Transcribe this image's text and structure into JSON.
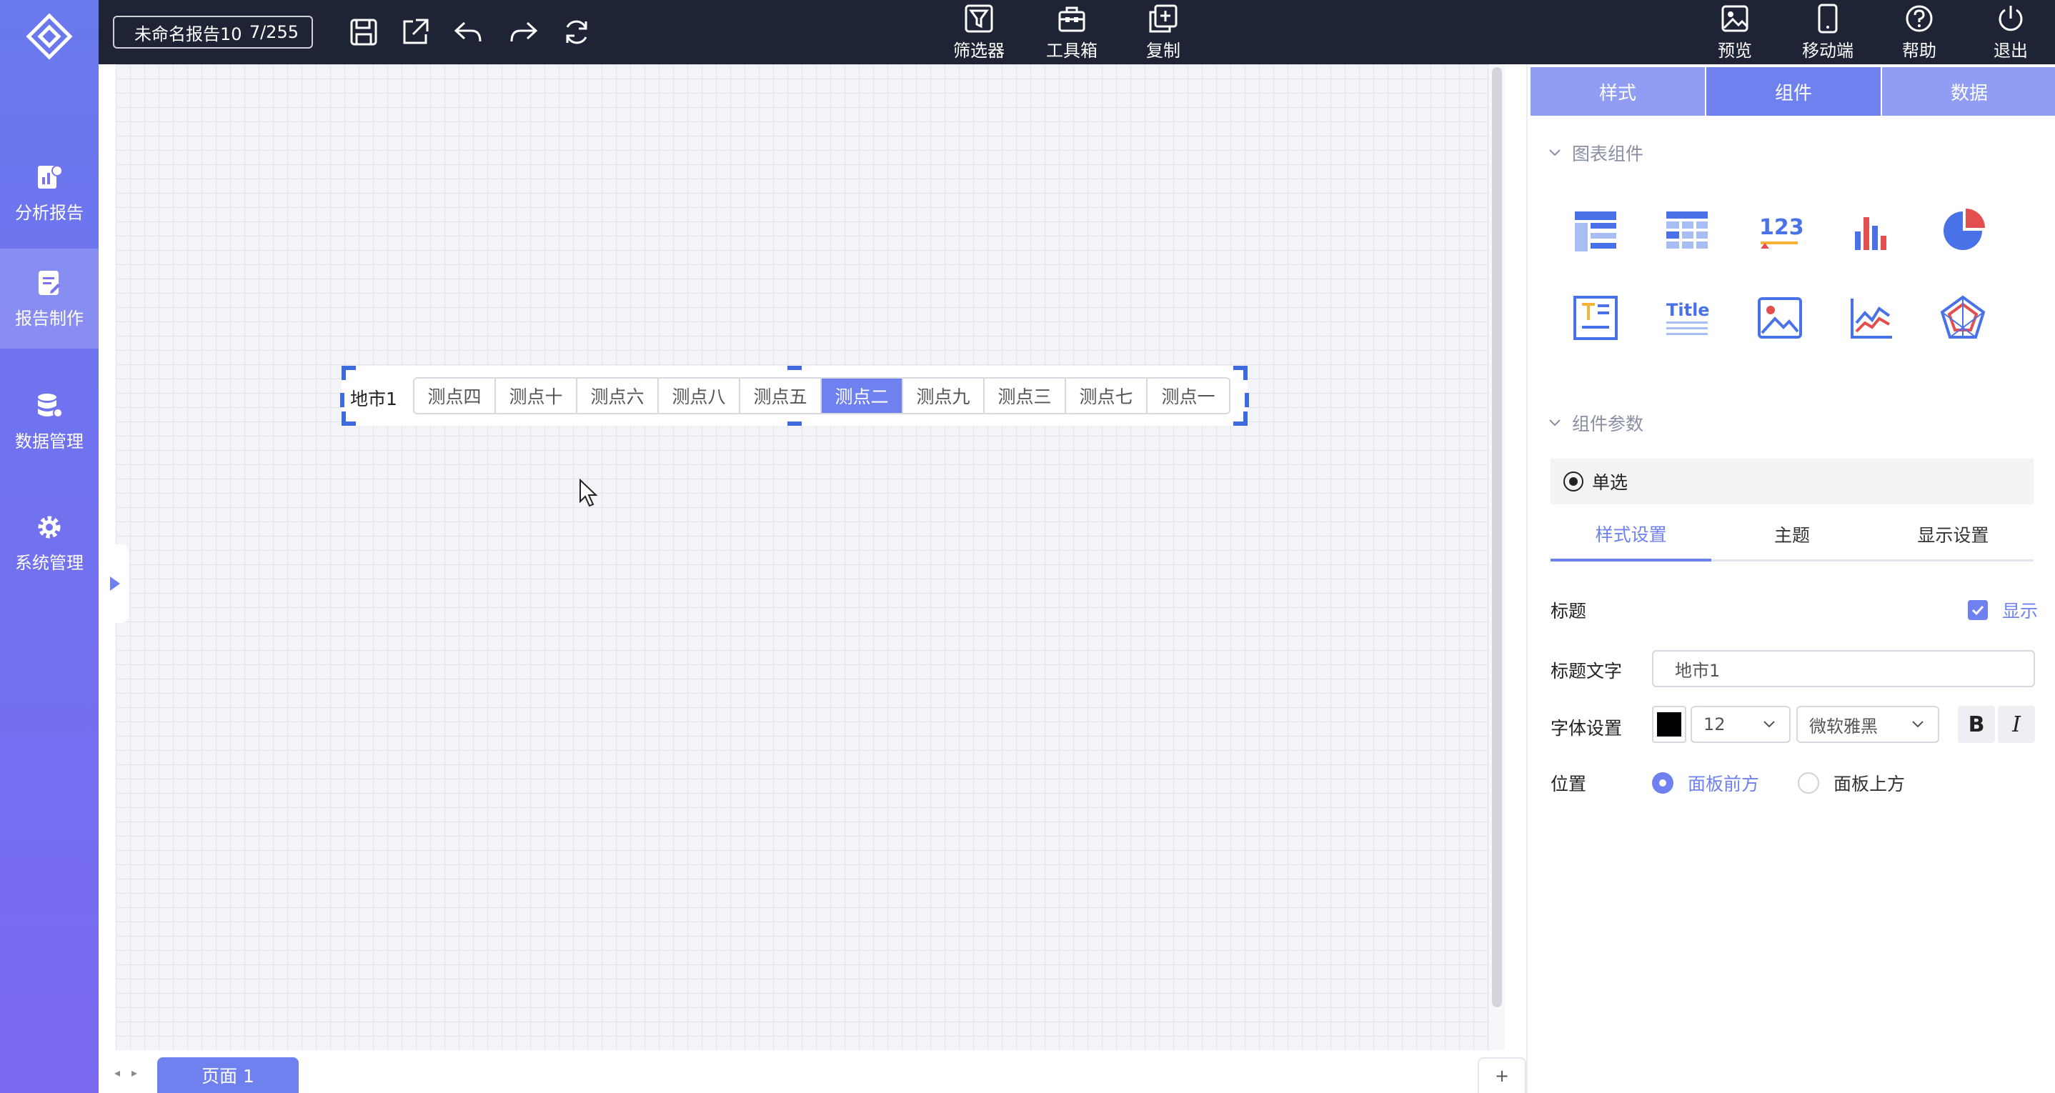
{
  "sidebar": {
    "items": [
      {
        "label": "分析报告",
        "icon": "chart-report-icon"
      },
      {
        "label": "报告制作",
        "icon": "report-edit-icon"
      },
      {
        "label": "数据管理",
        "icon": "database-icon"
      },
      {
        "label": "系统管理",
        "icon": "gear-icon"
      }
    ],
    "active_index": 1
  },
  "topbar": {
    "doc_name": "未命名报告10",
    "doc_count": "7/255",
    "center_buttons": [
      {
        "label": "筛选器",
        "icon": "filter-icon"
      },
      {
        "label": "工具箱",
        "icon": "toolbox-icon"
      },
      {
        "label": "复制",
        "icon": "copy-icon"
      }
    ],
    "right_buttons": [
      {
        "label": "预览",
        "icon": "preview-icon"
      },
      {
        "label": "移动端",
        "icon": "mobile-icon"
      },
      {
        "label": "帮助",
        "icon": "help-icon"
      },
      {
        "label": "退出",
        "icon": "power-icon"
      }
    ]
  },
  "widget": {
    "title": "地市1",
    "options": [
      "测点四",
      "测点十",
      "测点六",
      "测点八",
      "测点五",
      "测点二",
      "测点九",
      "测点三",
      "测点七",
      "测点一"
    ],
    "selected_index": 5
  },
  "pages": {
    "current": "页面 1",
    "add_label": "+",
    "prev": "◂",
    "next": "▸"
  },
  "panel": {
    "tabs": [
      "样式",
      "组件",
      "数据"
    ],
    "active_tab": 1,
    "chart_section": "图表组件",
    "chart_icons": [
      "table-icon",
      "pivot-table-icon",
      "number-card-icon",
      "bar-chart-icon",
      "pie-chart-icon",
      "text-box-icon",
      "title-icon",
      "image-icon",
      "line-chart-icon",
      "radar-chart-icon"
    ],
    "title_icon_text": "Title",
    "number_icon_text": "123",
    "params_section": "组件参数",
    "component_type": "单选",
    "subtabs": [
      "样式设置",
      "主题",
      "显示设置"
    ],
    "active_subtab": 0,
    "form": {
      "title_label": "标题",
      "show_label": "显示",
      "title_text_label": "标题文字",
      "title_text_value": "地市1",
      "font_label": "字体设置",
      "font_color": "#000000",
      "font_size": "12",
      "font_family": "微软雅黑",
      "bold": "B",
      "italic": "I",
      "position_label": "位置",
      "position_options": [
        "面板前方",
        "面板上方"
      ],
      "position_selected": 0
    }
  },
  "colors": {
    "accent": "#6f80ef",
    "topbar": "#1f2336",
    "sidebar": "#6a79ee"
  }
}
